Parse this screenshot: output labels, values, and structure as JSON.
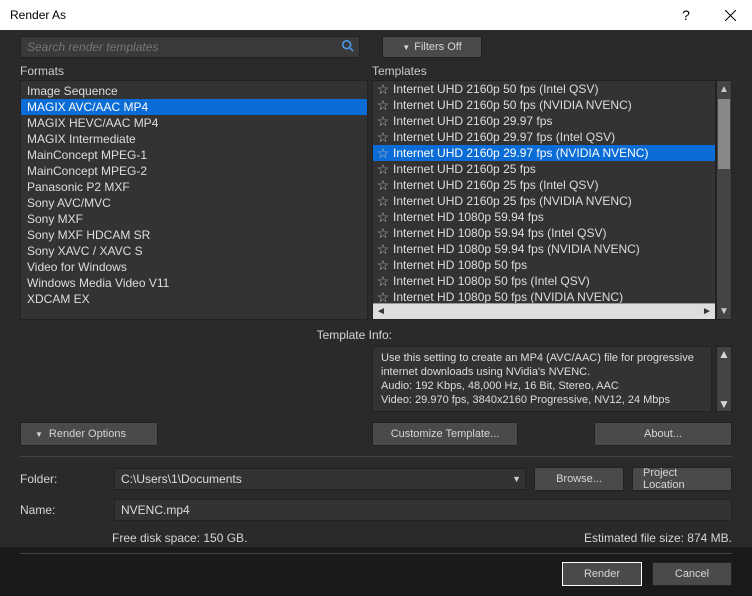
{
  "window": {
    "title": "Render As"
  },
  "search": {
    "placeholder": "Search render templates"
  },
  "filters_btn": "Filters Off",
  "labels": {
    "formats": "Formats",
    "templates": "Templates",
    "template_info": "Template Info:"
  },
  "formats": {
    "items": [
      "Image Sequence",
      "MAGIX AVC/AAC MP4",
      "MAGIX HEVC/AAC MP4",
      "MAGIX Intermediate",
      "MainConcept MPEG-1",
      "MainConcept MPEG-2",
      "Panasonic P2 MXF",
      "Sony AVC/MVC",
      "Sony MXF",
      "Sony MXF HDCAM SR",
      "Sony XAVC / XAVC S",
      "Video for Windows",
      "Windows Media Video V11",
      "XDCAM EX"
    ],
    "selected_index": 1
  },
  "templates": {
    "items": [
      "Internet UHD 2160p 50 fps (Intel QSV)",
      "Internet UHD 2160p 50 fps (NVIDIA NVENC)",
      "Internet UHD 2160p 29.97 fps",
      "Internet UHD 2160p 29.97 fps (Intel QSV)",
      "Internet UHD 2160p 29.97 fps (NVIDIA NVENC)",
      "Internet UHD 2160p 25 fps",
      "Internet UHD 2160p 25 fps (Intel QSV)",
      "Internet UHD 2160p 25 fps (NVIDIA NVENC)",
      "Internet HD 1080p 59.94 fps",
      "Internet HD 1080p 59.94 fps (Intel QSV)",
      "Internet HD 1080p 59.94 fps (NVIDIA NVENC)",
      "Internet HD 1080p 50 fps",
      "Internet HD 1080p 50 fps (Intel QSV)",
      "Internet HD 1080p 50 fps (NVIDIA NVENC)"
    ],
    "selected_index": 4
  },
  "template_info": {
    "lines": [
      "Use this setting to create an MP4 (AVC/AAC) file for progressive internet downloads using NVidia's NVENC.",
      "Audio: 192 Kbps, 48,000 Hz, 16 Bit, Stereo, AAC",
      "Video: 29.970 fps, 3840x2160 Progressive, NV12, 24 Mbps"
    ]
  },
  "buttons": {
    "render_options": "Render Options",
    "customize": "Customize Template...",
    "about": "About...",
    "browse": "Browse...",
    "project_location": "Project Location",
    "render": "Render",
    "cancel": "Cancel"
  },
  "fields": {
    "folder_label": "Folder:",
    "folder_value": "C:\\Users\\1\\Documents",
    "name_label": "Name:",
    "name_value": "NVENC.mp4"
  },
  "footer": {
    "free_space": "Free disk space: 150 GB.",
    "estimated": "Estimated file size: 874 MB."
  }
}
